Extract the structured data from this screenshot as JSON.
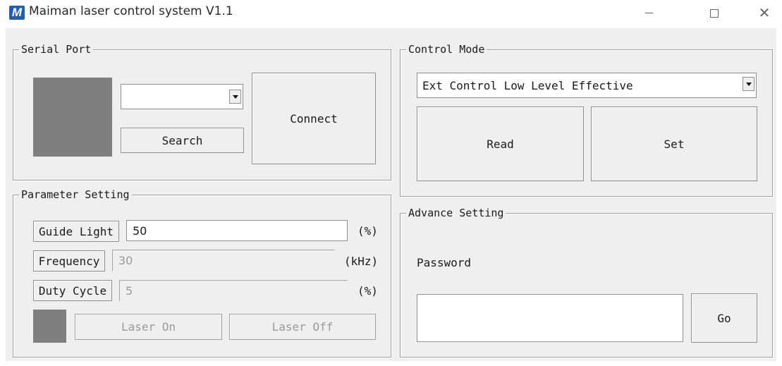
{
  "window": {
    "app_icon": "M",
    "title": "Maiman laser control system V1.1",
    "minimize_icon": "minimize-icon",
    "maximize_icon": "maximize-icon",
    "close_icon": "close-icon",
    "close_glyph": "✕"
  },
  "serial_port": {
    "title": "Serial Port",
    "port_value": "",
    "search_label": "Search",
    "connect_label": "Connect",
    "status_color": "#7f7f7f"
  },
  "parameter_setting": {
    "title": "Parameter Setting",
    "guide_light": {
      "label": "Guide Light",
      "value": "50",
      "unit": "(%)"
    },
    "frequency": {
      "label": "Frequency",
      "value": "30",
      "unit": "(kHz)"
    },
    "duty_cycle": {
      "label": "Duty Cycle",
      "value": "5",
      "unit": "(%)"
    },
    "laser_on_label": "Laser On",
    "laser_off_label": "Laser Off",
    "laser_status_color": "#7f7f7f"
  },
  "control_mode": {
    "title": "Control Mode",
    "mode_value": "Ext Control Low Level Effective",
    "read_label": "Read",
    "set_label": "Set"
  },
  "advance_setting": {
    "title": "Advance Setting",
    "password_label": "Password",
    "password_value": "",
    "go_label": "Go"
  }
}
